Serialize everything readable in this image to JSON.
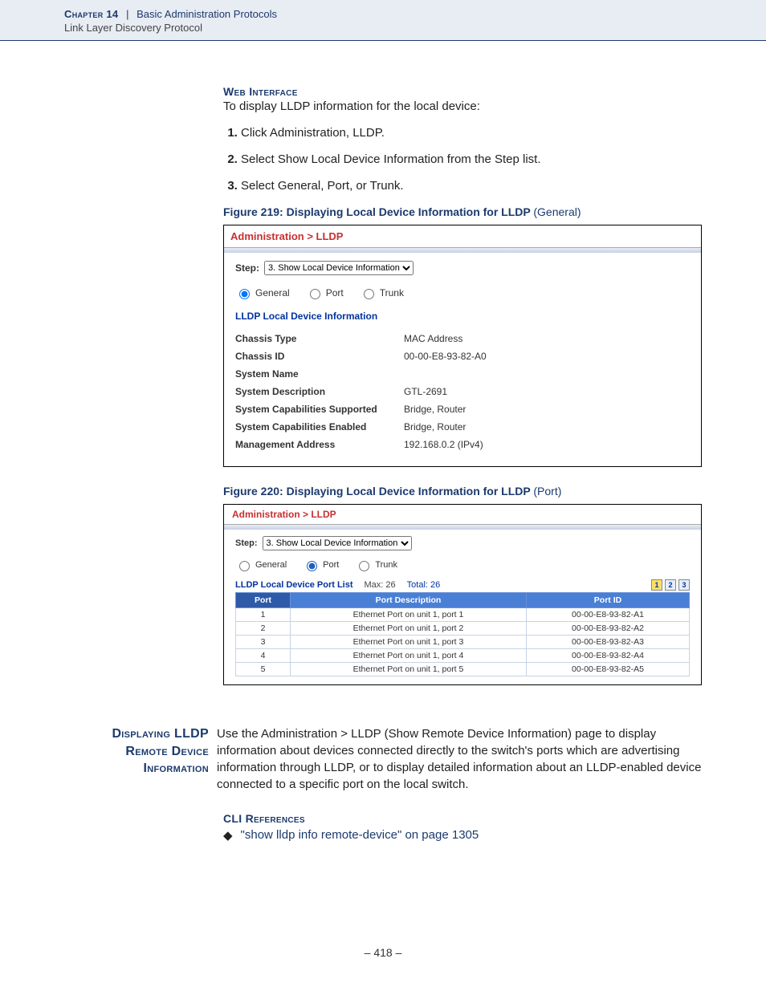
{
  "header": {
    "chapter": "Chapter 14",
    "separator": "|",
    "topic": "Basic Administration Protocols",
    "subtopic": "Link Layer Discovery Protocol"
  },
  "sections": {
    "web_interface_heading": "Web Interface",
    "web_interface_intro": "To display LLDP information for the local device:",
    "steps": [
      "Click Administration, LLDP.",
      "Select Show Local Device Information from the Step list.",
      "Select General, Port, or Trunk."
    ]
  },
  "figure219": {
    "caption_strong": "Figure 219:  Displaying Local Device Information for LLDP",
    "caption_paren": "(General)",
    "breadcrumb": "Administration > LLDP",
    "step_label": "Step:",
    "step_option": "3. Show Local Device Information",
    "radios": {
      "general": "General",
      "port": "Port",
      "trunk": "Trunk",
      "selected": "general"
    },
    "subheading": "LLDP Local Device Information",
    "rows": [
      {
        "label": "Chassis Type",
        "value": "MAC Address"
      },
      {
        "label": "Chassis ID",
        "value": "00-00-E8-93-82-A0"
      },
      {
        "label": "System Name",
        "value": ""
      },
      {
        "label": "System Description",
        "value": "GTL-2691"
      },
      {
        "label": "System Capabilities Supported",
        "value": "Bridge, Router"
      },
      {
        "label": "System Capabilities Enabled",
        "value": "Bridge, Router"
      },
      {
        "label": "Management Address",
        "value": "192.168.0.2 (IPv4)"
      }
    ]
  },
  "figure220": {
    "caption_strong": "Figure 220:  Displaying Local Device Information for LLDP",
    "caption_paren": "(Port)",
    "breadcrumb": "Administration > LLDP",
    "step_label": "Step:",
    "step_option": "3. Show Local Device Information",
    "radios": {
      "general": "General",
      "port": "Port",
      "trunk": "Trunk",
      "selected": "port"
    },
    "list_title": "LLDP Local Device Port List",
    "max_label": "Max: 26",
    "total_label": "Total: 26",
    "pager": [
      "1",
      "2",
      "3"
    ],
    "pager_active": "1",
    "columns": [
      "Port",
      "Port Description",
      "Port ID"
    ],
    "rows": [
      {
        "port": "1",
        "desc": "Ethernet Port on unit 1, port 1",
        "id": "00-00-E8-93-82-A1"
      },
      {
        "port": "2",
        "desc": "Ethernet Port on unit 1, port 2",
        "id": "00-00-E8-93-82-A2"
      },
      {
        "port": "3",
        "desc": "Ethernet Port on unit 1, port 3",
        "id": "00-00-E8-93-82-A3"
      },
      {
        "port": "4",
        "desc": "Ethernet Port on unit 1, port 4",
        "id": "00-00-E8-93-82-A4"
      },
      {
        "port": "5",
        "desc": "Ethernet Port on unit 1, port 5",
        "id": "00-00-E8-93-82-A5"
      }
    ]
  },
  "remote_section": {
    "heading_l1": "Displaying LLDP",
    "heading_l2": "Remote Device",
    "heading_l3": "Information",
    "body": "Use the Administration > LLDP (Show Remote Device Information) page to display information about devices connected directly to the switch's ports which are advertising information through LLDP, or to display detailed information about an LLDP-enabled device connected to a specific port on the local switch."
  },
  "cli": {
    "heading": "CLI References",
    "bullet_text": "\"show lldp info remote-device\" on page 1305"
  },
  "page_number": "–  418  –"
}
